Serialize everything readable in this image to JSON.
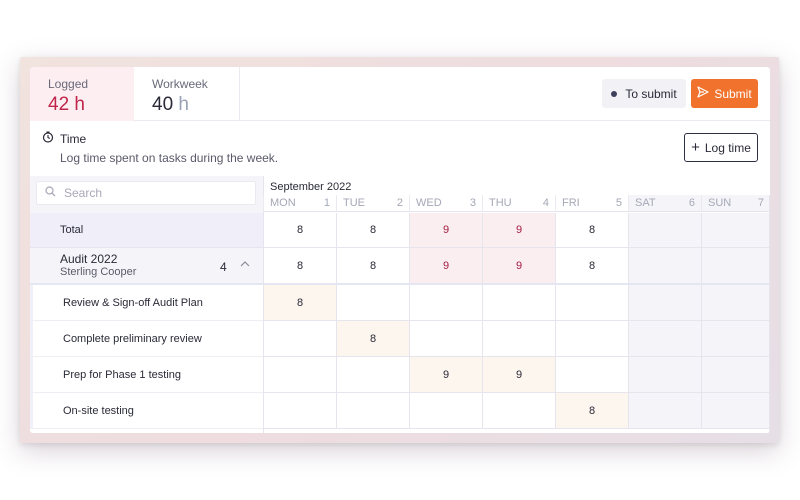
{
  "stats": {
    "logged_label": "Logged",
    "logged_value": "42",
    "logged_unit": "h",
    "workweek_label": "Workweek",
    "workweek_value": "40",
    "workweek_unit": "h"
  },
  "actions": {
    "to_submit_label": "To submit",
    "submit_label": "Submit",
    "log_time_label": "Log time"
  },
  "section": {
    "title": "Time",
    "description": "Log time spent on tasks during the week."
  },
  "search": {
    "placeholder": "Search"
  },
  "month": "September 2022",
  "days": [
    {
      "name": "MON",
      "num": "1"
    },
    {
      "name": "TUE",
      "num": "2"
    },
    {
      "name": "WED",
      "num": "3"
    },
    {
      "name": "THU",
      "num": "4"
    },
    {
      "name": "FRI",
      "num": "5"
    },
    {
      "name": "SAT",
      "num": "6"
    },
    {
      "name": "SUN",
      "num": "7"
    }
  ],
  "total": {
    "label": "Total",
    "values": [
      "8",
      "8",
      "9",
      "9",
      "8",
      "",
      ""
    ]
  },
  "client": {
    "name": "Audit 2022",
    "org": "Sterling Cooper",
    "count": "4",
    "values": [
      "8",
      "8",
      "9",
      "9",
      "8",
      "",
      ""
    ]
  },
  "tasks": [
    {
      "label": "Review & Sign-off Audit Plan",
      "values": [
        "8",
        "",
        "",
        "",
        "",
        "",
        ""
      ]
    },
    {
      "label": "Complete preliminary review",
      "values": [
        "",
        "8",
        "",
        "",
        "",
        "",
        ""
      ]
    },
    {
      "label": "Prep for Phase 1 testing",
      "values": [
        "",
        "",
        "9",
        "9",
        "",
        "",
        ""
      ]
    },
    {
      "label": "On-site testing",
      "values": [
        "",
        "",
        "",
        "",
        "8",
        "",
        ""
      ]
    }
  ],
  "colors": {
    "accent": "#f0722d",
    "over_hours": "#c0254a"
  }
}
